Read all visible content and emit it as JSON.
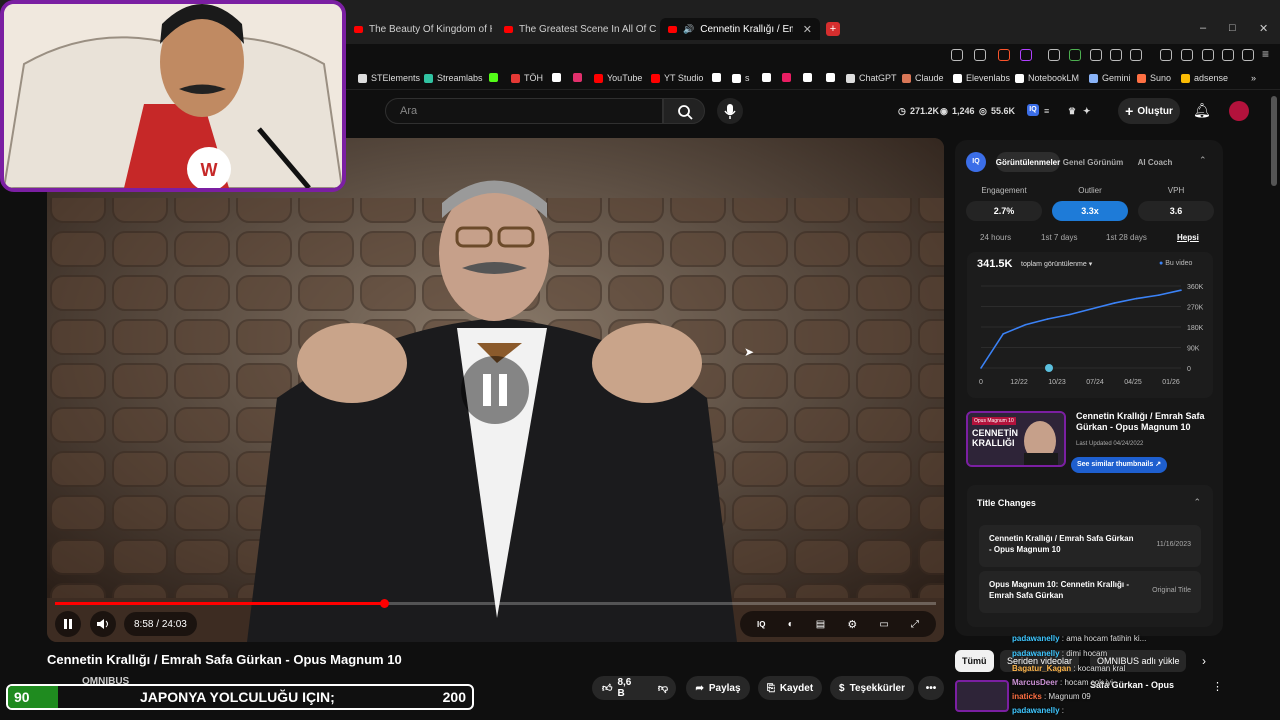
{
  "browser": {
    "tabs": [
      {
        "label": "The Beauty Of Kingdom of Heaven -"
      },
      {
        "label": "The Greatest Scene In All Of Cinema"
      },
      {
        "label": "Cennetin Krallığı / Emrah Safa"
      }
    ],
    "new_tab": "+",
    "window": {
      "minimize": "–",
      "maximize": "□",
      "close": "✕"
    }
  },
  "bookmarks": [
    {
      "label": "STElements",
      "color": "#dddddd"
    },
    {
      "label": "Streamlabs",
      "color": "#31c3a2"
    },
    {
      "label": "",
      "color": "#53fc18"
    },
    {
      "label": "TÖH",
      "color": "#e53935"
    },
    {
      "label": "",
      "color": "#ffffff"
    },
    {
      "label": "",
      "color": "#e1306c"
    },
    {
      "label": "YouTube",
      "color": "#ff0000"
    },
    {
      "label": "YT Studio",
      "color": "#ff0000"
    },
    {
      "label": "",
      "color": "#ffffff"
    },
    {
      "label": "s",
      "color": "#ffffff"
    },
    {
      "label": "",
      "color": "#ffffff"
    },
    {
      "label": "",
      "color": "#e91e63"
    },
    {
      "label": "",
      "color": "#ffffff"
    },
    {
      "label": "",
      "color": "#ffffff"
    },
    {
      "label": "ChatGPT",
      "color": "#dddddd"
    },
    {
      "label": "Claude",
      "color": "#d97757"
    },
    {
      "label": "Elevenlabs",
      "color": "#ffffff"
    },
    {
      "label": "NotebookLM",
      "color": "#ffffff"
    },
    {
      "label": "Gemini",
      "color": "#8ab4f8"
    },
    {
      "label": "Suno",
      "color": "#ff7043"
    },
    {
      "label": "adsense",
      "color": "#fbbc04"
    }
  ],
  "header": {
    "search_placeholder": "Ara",
    "stats": {
      "views": "271.2K",
      "watching": "1,246",
      "subs": "55.6K"
    },
    "create_label": "Oluştur"
  },
  "player": {
    "current_time": "8:58",
    "separator": " / ",
    "duration": "24:03",
    "progress": 0.373
  },
  "video": {
    "title": "Cennetin Krallığı / Emrah Safa Gürkan - Opus Magnum 10",
    "channel": "OMNIBUS",
    "likes": "8,6 B",
    "share_label": "Paylaş",
    "save_label": "Kaydet",
    "thanks_label": "Teşekkürler",
    "more_label": "•••"
  },
  "banner": {
    "left_value": "90",
    "text": "JAPONYA YOLCULUĞU IÇIN;",
    "right_value": "200"
  },
  "panel": {
    "logo": "IQ",
    "tabs": [
      "Görüntülenmeler",
      "Genel Görünüm",
      "AI Coach"
    ],
    "metrics": [
      {
        "label": "Engagement",
        "value": "2.7%"
      },
      {
        "label": "Outlier",
        "value": "3.3x"
      },
      {
        "label": "VPH",
        "value": "3.6"
      }
    ],
    "ranges": [
      "24 hours",
      "1st 7 days",
      "1st 28 days",
      "Hepsi"
    ],
    "total_views": "341.5K",
    "views_dropdown": "toplam görüntülenme",
    "legend": "Bu video",
    "similar": {
      "title": "Cennetin Krallığı / Emrah Safa Gürkan - Opus Magnum 10",
      "updated": "Last Updated 04/24/2022",
      "button": "See similar thumbnails",
      "thumb_tag": "Opus Magnum 10",
      "thumb_text": "CENNETİN KRALLIĞI"
    },
    "title_changes": {
      "heading": "Title Changes",
      "rows": [
        {
          "title": "Cennetin Krallığı / Emrah Safa Gürkan - Opus Magnum 10",
          "date": "11/16/2023"
        },
        {
          "title": "Opus Magnum 10: Cennetin Krallığı - Emrah Safa Gürkan",
          "date": "Original Title"
        }
      ]
    }
  },
  "chart_data": {
    "type": "line",
    "x": [
      "0",
      "12/22",
      "10/23",
      "07/24",
      "04/25",
      "01/26"
    ],
    "y_ticks": [
      "360K",
      "270K",
      "180K",
      "90K",
      "0"
    ],
    "ylim": [
      0,
      360000
    ],
    "series": [
      {
        "name": "Bu video",
        "values": [
          0,
          150000,
          190000,
          215000,
          235000,
          260000,
          285000,
          305000,
          320000,
          341500
        ]
      }
    ]
  },
  "chips": [
    "Tümü",
    "Seriden videolar",
    "OMNIBUS adlı yükle"
  ],
  "chat": [
    {
      "user": "padawanelly",
      "msg": "ama hocam fatihin ki..."
    },
    {
      "user": "padawanelly",
      "msg": "dimi hocam"
    },
    {
      "user": "Bagatur_Kagan",
      "msg": "kocaman kral"
    },
    {
      "user": "MarcusDeer",
      "msg": "hocam çok iyi"
    },
    {
      "user": "inaticks",
      "msg": "Magnum 09"
    },
    {
      "user": "padawanelly",
      "msg": ""
    }
  ],
  "side_video_title": "Safa Gürkan - Opus"
}
